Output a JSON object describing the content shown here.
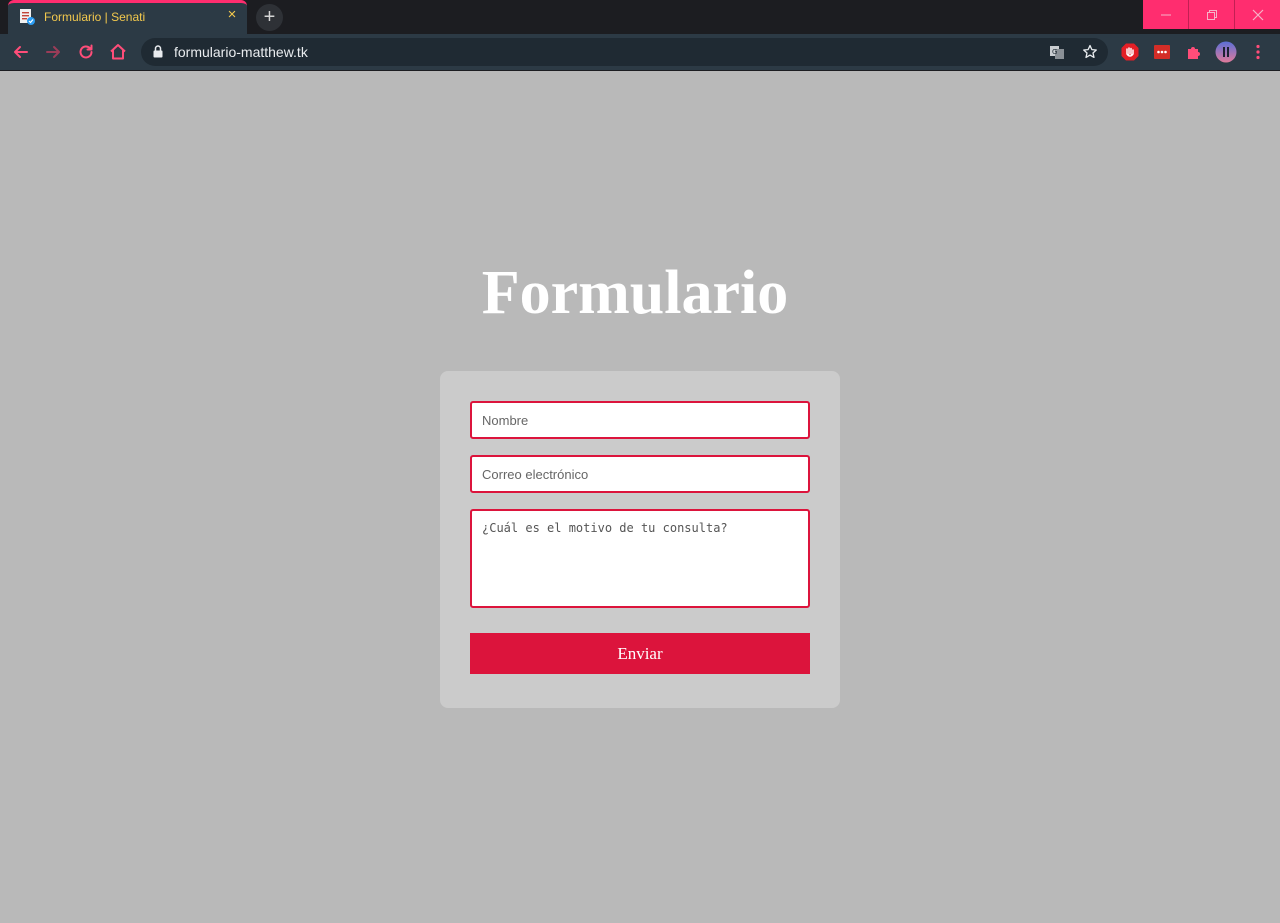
{
  "browser": {
    "tab_title": "Formulario | Senati",
    "tab_close": "×",
    "new_tab": "+",
    "url": "formulario-matthew.tk",
    "colors": {
      "accent": "#ff2d6f",
      "tab_text": "#f3c94d",
      "toolbar": "#2c3a45",
      "tabbar": "#1c1d21"
    }
  },
  "page": {
    "title": "Formulario",
    "form": {
      "name_placeholder": "Nombre",
      "email_placeholder": "Correo electrónico",
      "message_placeholder": "¿Cuál es el motivo de tu consulta?",
      "submit_label": "Enviar"
    },
    "colors": {
      "background": "#b9b9b9",
      "card": "#cbcbcb",
      "primary": "#dc143c"
    }
  },
  "icons": [
    "favicon-icon",
    "close-icon",
    "plus-icon",
    "minimize-icon",
    "maximize-icon",
    "window-close-icon",
    "back-icon",
    "forward-icon",
    "reload-icon",
    "home-icon",
    "lock-icon",
    "translate-icon",
    "star-icon",
    "adblock-icon",
    "lastpass-icon",
    "extensions-icon",
    "profile-avatar",
    "menu-icon"
  ]
}
